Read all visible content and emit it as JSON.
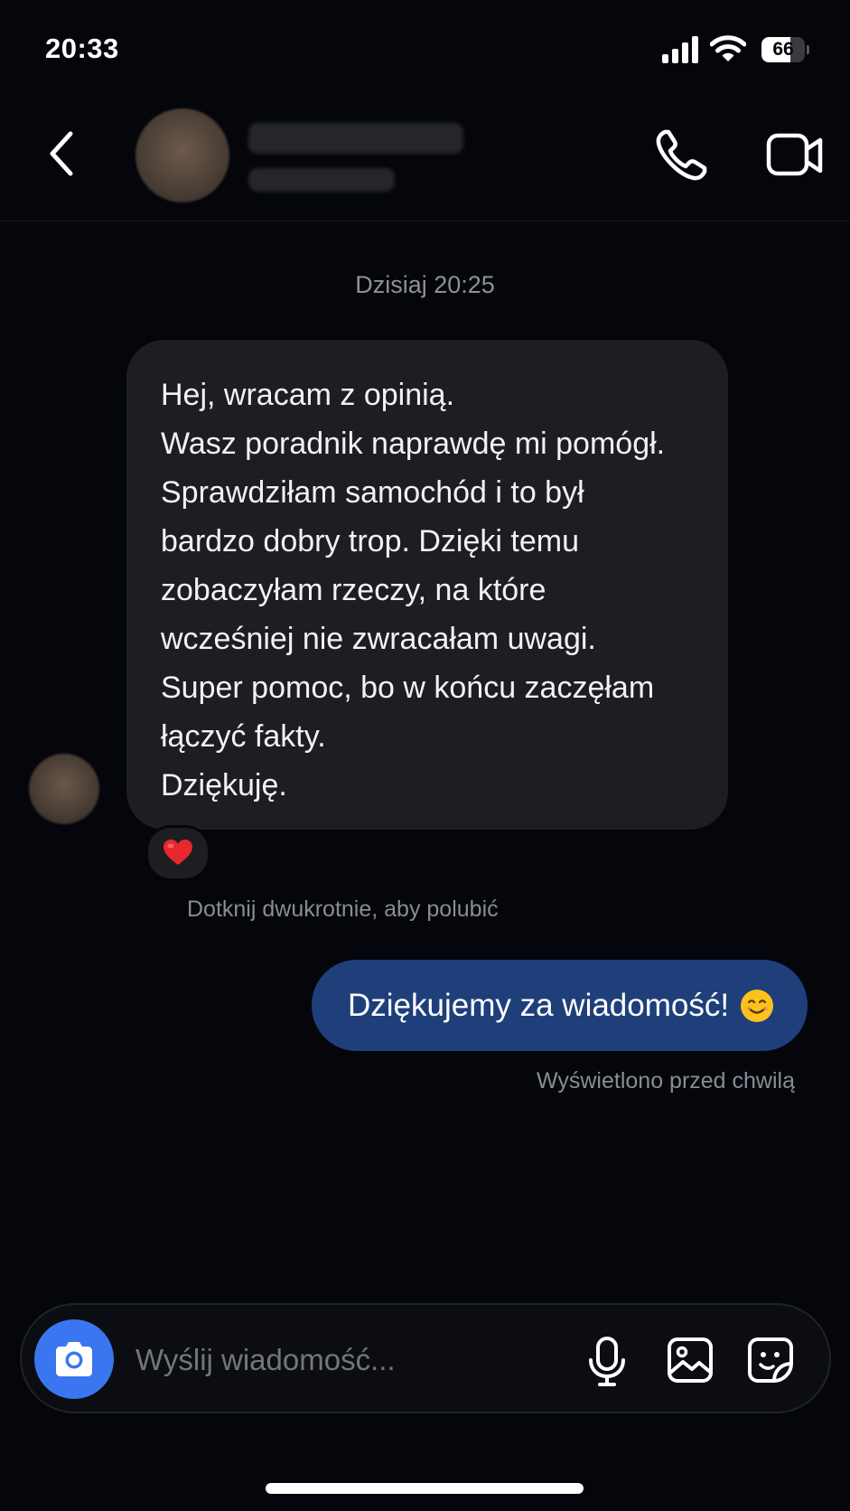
{
  "status_bar": {
    "time": "20:33",
    "battery_percent": "66",
    "battery_level": 0.66,
    "icons": [
      "signal-icon",
      "wifi-icon",
      "battery-icon"
    ]
  },
  "header": {
    "back_icon": "chevron-left-icon",
    "call_icon": "phone-icon",
    "video_icon": "video-camera-icon"
  },
  "conversation": {
    "timestamp": "Dzisiaj 20:25",
    "incoming_message": {
      "lines": [
        "Hej, wracam z opinią.",
        "Wasz poradnik naprawdę mi pomógł.",
        "Sprawdziłam samochód i to był",
        "bardzo dobry trop. Dzięki temu",
        "zobaczyłam rzeczy, na które",
        "wcześniej nie zwracałam uwagi.",
        "Super pomoc, bo w końcu zaczęłam",
        "łączyć fakty.",
        "Dziękuję."
      ],
      "reaction": "heart-icon"
    },
    "double_tap_hint": "Dotknij dwukrotnie, aby polubić",
    "outgoing_message": {
      "text": "Dziękujemy za wiadomość!",
      "emoji": "smiling-face-icon"
    },
    "seen_status": "Wyświetlono przed chwilą"
  },
  "composer": {
    "placeholder": "Wyślij wiadomość...",
    "camera_icon": "camera-icon",
    "mic_icon": "microphone-icon",
    "gallery_icon": "image-icon",
    "sticker_icon": "sticker-icon"
  },
  "colors": {
    "background": "#04060c",
    "incoming_bubble": "#1c1e22",
    "outgoing_bubble": "#1f3f7a",
    "camera_button": "#3a76ef",
    "secondary_text": "#8a8c93"
  }
}
